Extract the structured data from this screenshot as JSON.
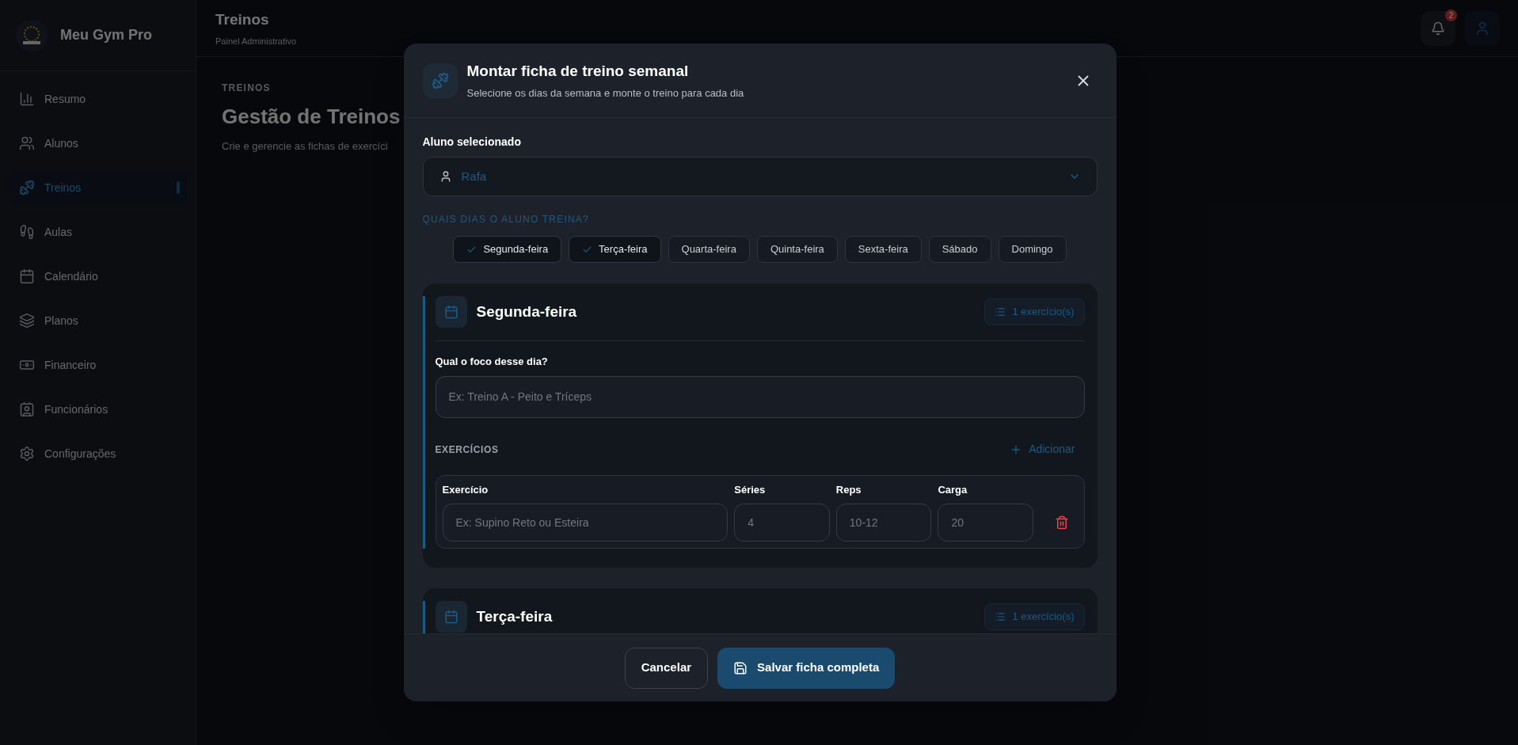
{
  "brand": {
    "name": "Meu Gym Pro"
  },
  "sidebar": {
    "items": [
      {
        "label": "Resumo",
        "selected": false
      },
      {
        "label": "Alunos",
        "selected": false
      },
      {
        "label": "Treinos",
        "selected": true
      },
      {
        "label": "Aulas",
        "selected": false
      },
      {
        "label": "Calendário",
        "selected": false
      },
      {
        "label": "Planos",
        "selected": false
      },
      {
        "label": "Financeiro",
        "selected": false
      },
      {
        "label": "Funcionários",
        "selected": false
      },
      {
        "label": "Configurações",
        "selected": false
      }
    ]
  },
  "header": {
    "title": "Treinos",
    "subtitle": "Painel Administrativo",
    "notifications": "2"
  },
  "page": {
    "eyebrow": "TREINOS",
    "title": "Gestão de Treinos",
    "subtitle": "Crie e gerencie as fichas de exercíci"
  },
  "modal": {
    "title": "Montar ficha de treino semanal",
    "subtitle": "Selecione os dias da semana e monte o treino para cada dia",
    "student_label": "Aluno selecionado",
    "student_value": "Rafa",
    "days_label": "QUAIS DIAS O ALUNO TREINA?",
    "days": [
      {
        "label": "Segunda-feira",
        "selected": true
      },
      {
        "label": "Terça-feira",
        "selected": true
      },
      {
        "label": "Quarta-feira",
        "selected": false
      },
      {
        "label": "Quinta-feira",
        "selected": false
      },
      {
        "label": "Sexta-feira",
        "selected": false
      },
      {
        "label": "Sábado",
        "selected": false
      },
      {
        "label": "Domingo",
        "selected": false
      }
    ],
    "day_cards": [
      {
        "title": "Segunda-feira",
        "count": "1 exercício(s)",
        "focus_label": "Qual o foco desse dia?",
        "focus_placeholder": "Ex: Treino A - Peito e Tríceps",
        "exercises_label": "EXERCÍCIOS",
        "add_label": "Adicionar",
        "exercises": [
          {
            "fields": [
              {
                "label": "Exercício",
                "placeholder": "Ex: Supino Reto ou Esteira"
              },
              {
                "label": "Séries",
                "placeholder": "4"
              },
              {
                "label": "Reps",
                "placeholder": "10-12"
              },
              {
                "label": "Carga",
                "placeholder": "20"
              }
            ]
          }
        ]
      },
      {
        "title": "Terça-feira",
        "count": "1 exercício(s)"
      }
    ],
    "buttons": {
      "cancel": "Cancelar",
      "save": "Salvar ficha completa"
    }
  }
}
